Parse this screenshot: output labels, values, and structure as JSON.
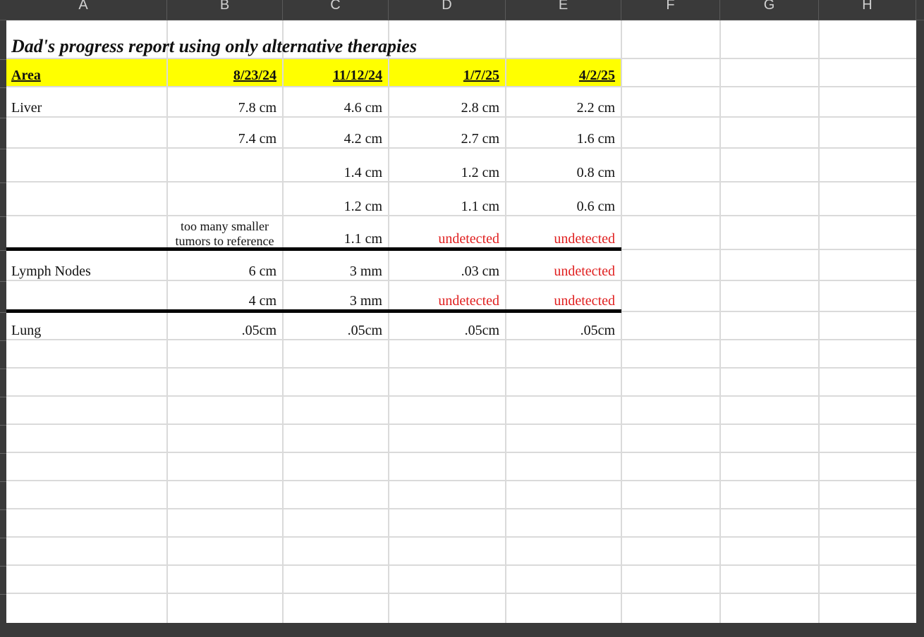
{
  "columns": [
    "A",
    "B",
    "C",
    "D",
    "E",
    "F",
    "G",
    "H"
  ],
  "sheet": {
    "title": "Dad's progress report using only alternative therapies",
    "headers": {
      "area": "Area",
      "dates": [
        "8/23/24",
        "11/12/24",
        "1/7/25",
        "4/2/25"
      ]
    },
    "rows": [
      {
        "area": "Liver",
        "values": [
          "7.8 cm",
          "4.6 cm",
          "2.8 cm",
          "2.2 cm"
        ]
      },
      {
        "area": "",
        "values": [
          "7.4 cm",
          "4.2 cm",
          "2.7 cm",
          "1.6 cm"
        ]
      },
      {
        "area": "",
        "values": [
          "",
          "1.4 cm",
          "1.2 cm",
          "0.8 cm"
        ]
      },
      {
        "area": "",
        "values": [
          "",
          "1.2 cm",
          "1.1 cm",
          "0.6 cm"
        ]
      },
      {
        "area": "",
        "values": [
          "too many smaller tumors to reference",
          "1.1 cm",
          "undetected",
          "undetected"
        ]
      },
      {
        "area": "Lymph Nodes",
        "values": [
          "6 cm",
          "3 mm",
          ".03 cm",
          "undetected"
        ]
      },
      {
        "area": "",
        "values": [
          "4 cm",
          "3 mm",
          "undetected",
          "undetected"
        ]
      },
      {
        "area": "Lung",
        "values": [
          ".05cm",
          ".05cm",
          ".05cm",
          ".05cm"
        ]
      }
    ],
    "highlight_color": "#ffff00",
    "warning_color": "#e02020"
  }
}
